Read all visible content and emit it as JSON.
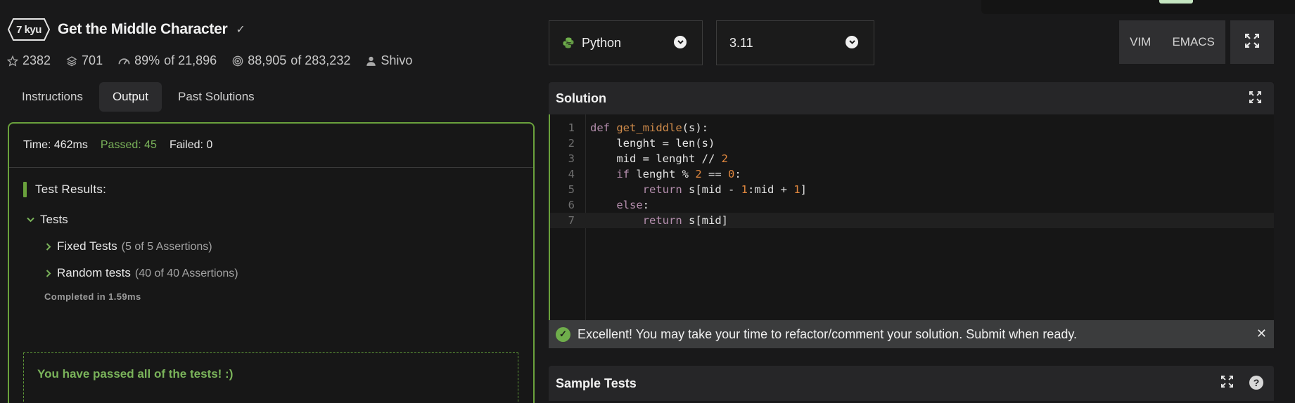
{
  "kata": {
    "rank": "7 kyu",
    "title": "Get the Middle Character",
    "stars": "2382",
    "collections": "701",
    "satisfaction": "89%",
    "satisfaction_of": "of 21,896",
    "completed": "88,905",
    "completed_of": "of 283,232",
    "author": "Shivo"
  },
  "tabs": [
    "Instructions",
    "Output",
    "Past Solutions"
  ],
  "output": {
    "time": "Time: 462ms",
    "passed": "Passed: 45",
    "failed": "Failed: 0",
    "results_title": "Test Results:",
    "group": "Tests",
    "items": [
      {
        "name": "Fixed Tests",
        "assertions": "(5 of 5 Assertions)"
      },
      {
        "name": "Random tests",
        "assertions": "(40 of 40 Assertions)"
      }
    ],
    "completed_in": "Completed in 1.59ms",
    "passed_message": "You have passed all of the tests! :)"
  },
  "language": "Python",
  "version": "3.11",
  "editor_modes": [
    "VIM",
    "EMACS"
  ],
  "solution": {
    "title": "Solution",
    "line_numbers": [
      "1",
      "2",
      "3",
      "4",
      "5",
      "6",
      "7"
    ],
    "notice": "Excellent! You may take your time to refactor/comment your solution. Submit when ready."
  },
  "sample_tests": {
    "title": "Sample Tests",
    "help": "?"
  },
  "colors": {
    "accent_green": "#6aa13c",
    "passed_text": "#7ab35a",
    "keyword": "#b48ead",
    "number": "#e0873e"
  }
}
